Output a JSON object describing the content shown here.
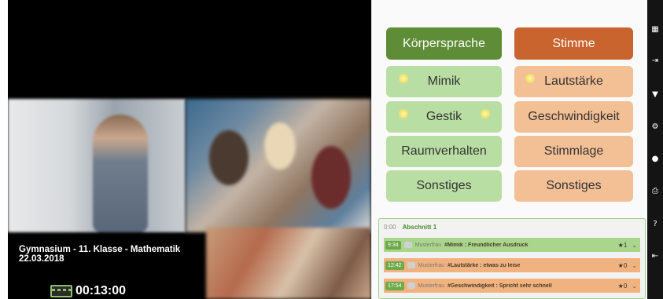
{
  "video": {
    "caption_line1": "Gymnasium - 11. Klasse - Mathematik",
    "caption_line2": "22.03.2018",
    "timer": "00:13:00"
  },
  "categories": {
    "left_header": "Körpersprache",
    "right_header": "Stimme",
    "left_items": [
      "Mimik",
      "Gestik",
      "Raumverhalten",
      "Sonstiges"
    ],
    "right_items": [
      "Lautstärke",
      "Geschwindigkeit",
      "Stimmlage",
      "Sonstiges"
    ]
  },
  "log": {
    "time": "0:00",
    "section": "Abschnitt 1",
    "entries": [
      {
        "time": "9:34",
        "author": "Musterfrau",
        "text": "#Mimik : Freundlicher Ausdruck",
        "stars": "★1",
        "color": "green"
      },
      {
        "time": "12:42",
        "author": "Musterfrau",
        "text": "#Lautstärke : etwas zu leise",
        "stars": "★0",
        "color": "orange"
      },
      {
        "time": "17:54",
        "author": "Musterfrau",
        "text": "#Geschwindigkeit : Spricht sehr schnell",
        "stars": "★0",
        "color": "orange"
      }
    ]
  },
  "colors": {
    "green_header": "#5e8c37",
    "orange_header": "#c9642f",
    "green_button": "#b9dea3",
    "orange_button": "#f3bf95"
  },
  "toolbar_icons": [
    "grid-icon",
    "export-icon",
    "filter-icon",
    "settings-icon",
    "user-icon",
    "print-icon",
    "help-icon",
    "logout-icon"
  ]
}
